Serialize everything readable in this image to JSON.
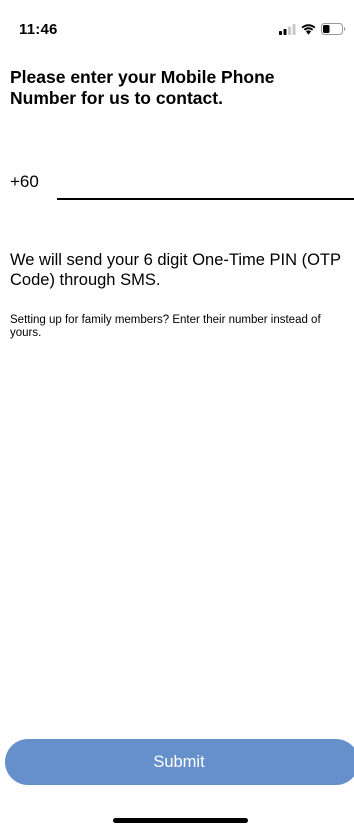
{
  "status_bar": {
    "time": "11:46",
    "icons": [
      "cellular-signal-icon",
      "wifi-icon",
      "battery-icon"
    ]
  },
  "page": {
    "title": "Please enter your Mobile Phone Number for us to contact."
  },
  "phone": {
    "country_code": "+60",
    "value": "",
    "placeholder": ""
  },
  "info": {
    "otp_text": "We will send your 6 digit One-Time PIN (OTP Code) through SMS.",
    "family_note": "Setting up for family members? Enter their number instead of yours."
  },
  "actions": {
    "submit_label": "Submit"
  },
  "colors": {
    "submit_button": "#6690cc",
    "text": "#000000",
    "background": "#ffffff"
  }
}
